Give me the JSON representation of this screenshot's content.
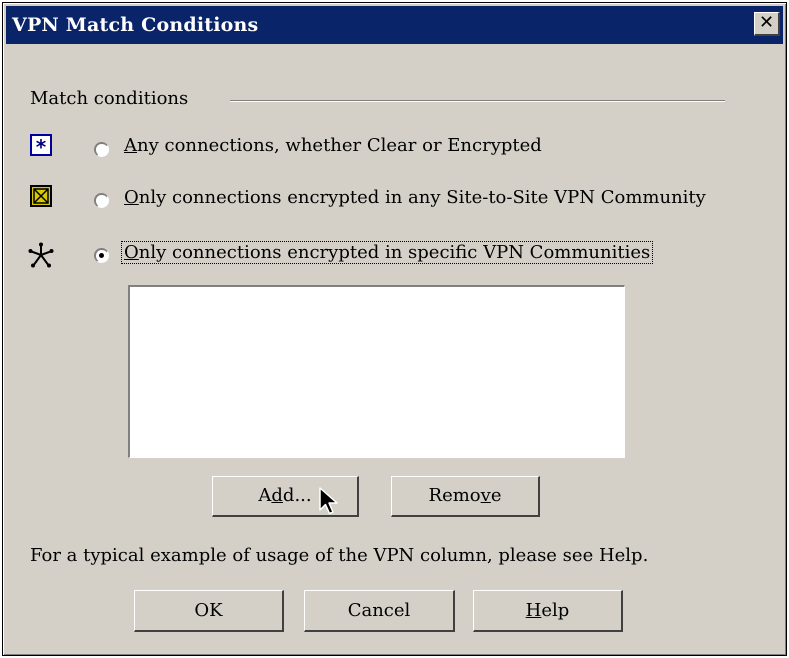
{
  "window": {
    "title": "VPN Match Conditions",
    "close_symbol": "✕"
  },
  "group": {
    "label": "Match conditions"
  },
  "options": [
    {
      "icon": "asterisk-icon",
      "label_u": "A",
      "label_rest": "ny connections, whether Clear or Encrypted",
      "selected": false
    },
    {
      "icon": "mesh-community-icon",
      "label_u": "O",
      "label_rest": "nly connections encrypted in any Site-to-Site VPN Community",
      "selected": false
    },
    {
      "icon": "star-community-icon",
      "label_u": "O",
      "label_rest": "nly connections encrypted in specific VPN Communities",
      "selected": true
    }
  ],
  "list": {
    "items": []
  },
  "buttons": {
    "add_pre": "A",
    "add_u": "d",
    "add_post": "d...",
    "remove_pre": "Remo",
    "remove_u": "v",
    "remove_post": "e",
    "ok": "OK",
    "cancel": "Cancel",
    "help_u": "H",
    "help_rest": "elp"
  },
  "footer": {
    "note": "For a typical example of usage of the VPN column, please see Help."
  },
  "colors": {
    "titlebar": "#0a246a",
    "dialog_bg": "#d4d0c8",
    "asterisk_border": "#0000a0",
    "mesh_fill": "#d8c800"
  }
}
